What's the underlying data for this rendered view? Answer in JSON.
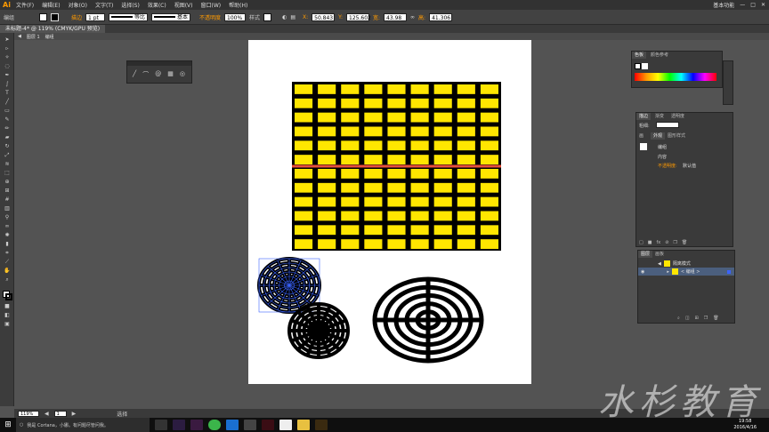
{
  "app": {
    "logo": "Ai",
    "workspace": "基本功能",
    "menus": [
      "文件(F)",
      "编辑(E)",
      "对象(O)",
      "文字(T)",
      "选择(S)",
      "效果(C)",
      "视图(V)",
      "窗口(W)",
      "帮助(H)"
    ]
  },
  "control": {
    "mode": "编组",
    "stroke_label": "描边",
    "stroke_value": "1 pt",
    "profile_label": "等比",
    "brush_label": "基本",
    "opacity_label": "不透明度",
    "opacity_value": "100%",
    "style_label": "样式",
    "x_label": "X:",
    "x_value": "50.843",
    "y_label": "Y:",
    "y_value": "125.602",
    "w_label": "宽:",
    "w_value": "43.98",
    "h_label": "高:",
    "h_value": "41.306"
  },
  "document": {
    "tab": "未标题-4* @ 119% (CMYK/GPU 预览)",
    "crumb_layer": "图层 1",
    "crumb_group": "编组"
  },
  "swatches_panel": {
    "tabs": [
      "色板",
      "颜色参考"
    ]
  },
  "appearance_panel": {
    "tabs": [
      "描边",
      "渐变",
      "透明度"
    ],
    "subtabs": [
      "画",
      "外观",
      "图形样式"
    ],
    "width_label": "粗细:",
    "group_label": "编组",
    "content_label": "内容",
    "opacity_label": "不透明度:",
    "opacity_value": "默认值"
  },
  "layers_panel": {
    "tabs": [
      "图层",
      "画板"
    ],
    "isolation_label": "隔离模式",
    "group_label": "< 编组 >"
  },
  "statusbar": {
    "zoom": "119%",
    "page": "1",
    "tool": "选择"
  },
  "taskbar": {
    "search": "我是 Cortana，小娜。有问题尽管问我。",
    "time": "19:58",
    "date": "2016/4/16"
  },
  "watermark": "水杉教育",
  "colors": {
    "accent": "#ff9a00",
    "grid_fill": "#ffe600",
    "guide": "#e8503a",
    "selection": "#3a63ff"
  }
}
